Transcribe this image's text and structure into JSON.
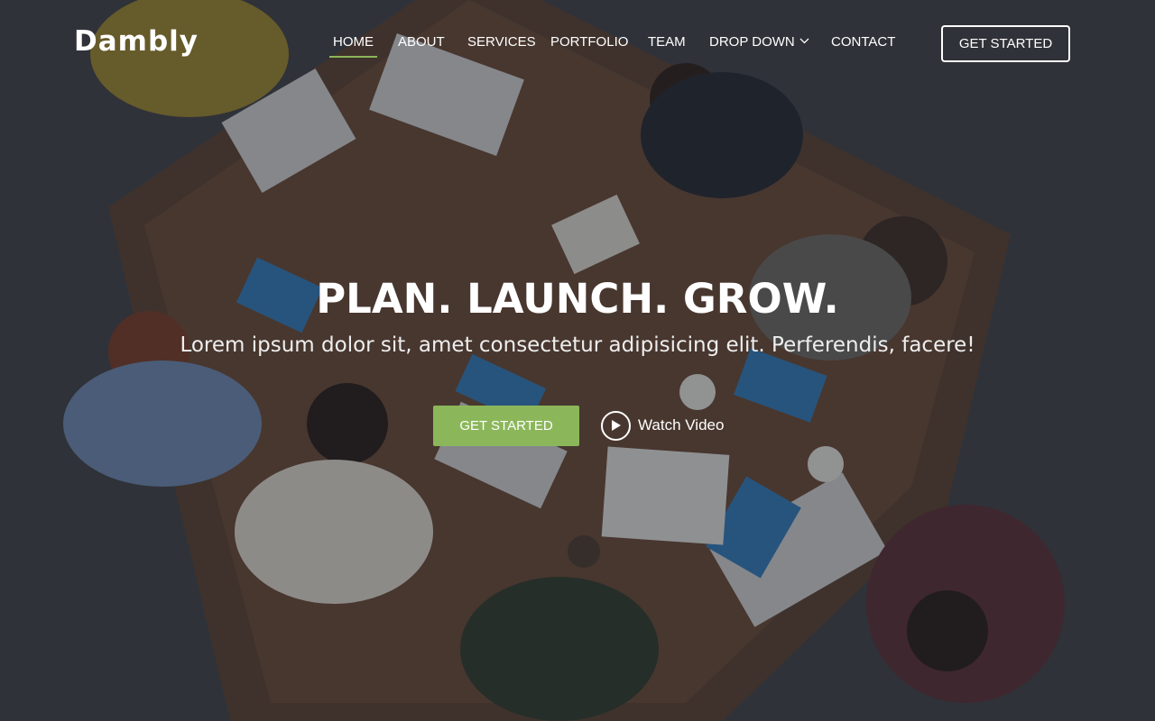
{
  "brand": {
    "logo": "Dambly"
  },
  "nav": {
    "items": [
      {
        "label": "HOME",
        "active": true
      },
      {
        "label": "ABOUT"
      },
      {
        "label": "SERVICES"
      },
      {
        "label": "PORTFOLIO"
      },
      {
        "label": "TEAM"
      },
      {
        "label": "DROP DOWN",
        "icon": "chevron-down-icon"
      },
      {
        "label": "CONTACT"
      }
    ],
    "cta_label": "GET STARTED"
  },
  "hero": {
    "title": "PLAN. LAUNCH. GROW.",
    "subtitle": "Lorem ipsum dolor sit, amet consectetur adipisicing elit. Perferendis, facere!",
    "primary_button": "GET STARTED",
    "video_link": "Watch Video",
    "video_icon": "play-icon",
    "background": "overhead photo of team meeting around wooden table with laptops"
  },
  "colors": {
    "accent": "#8bb75a",
    "text": "#ffffff"
  }
}
